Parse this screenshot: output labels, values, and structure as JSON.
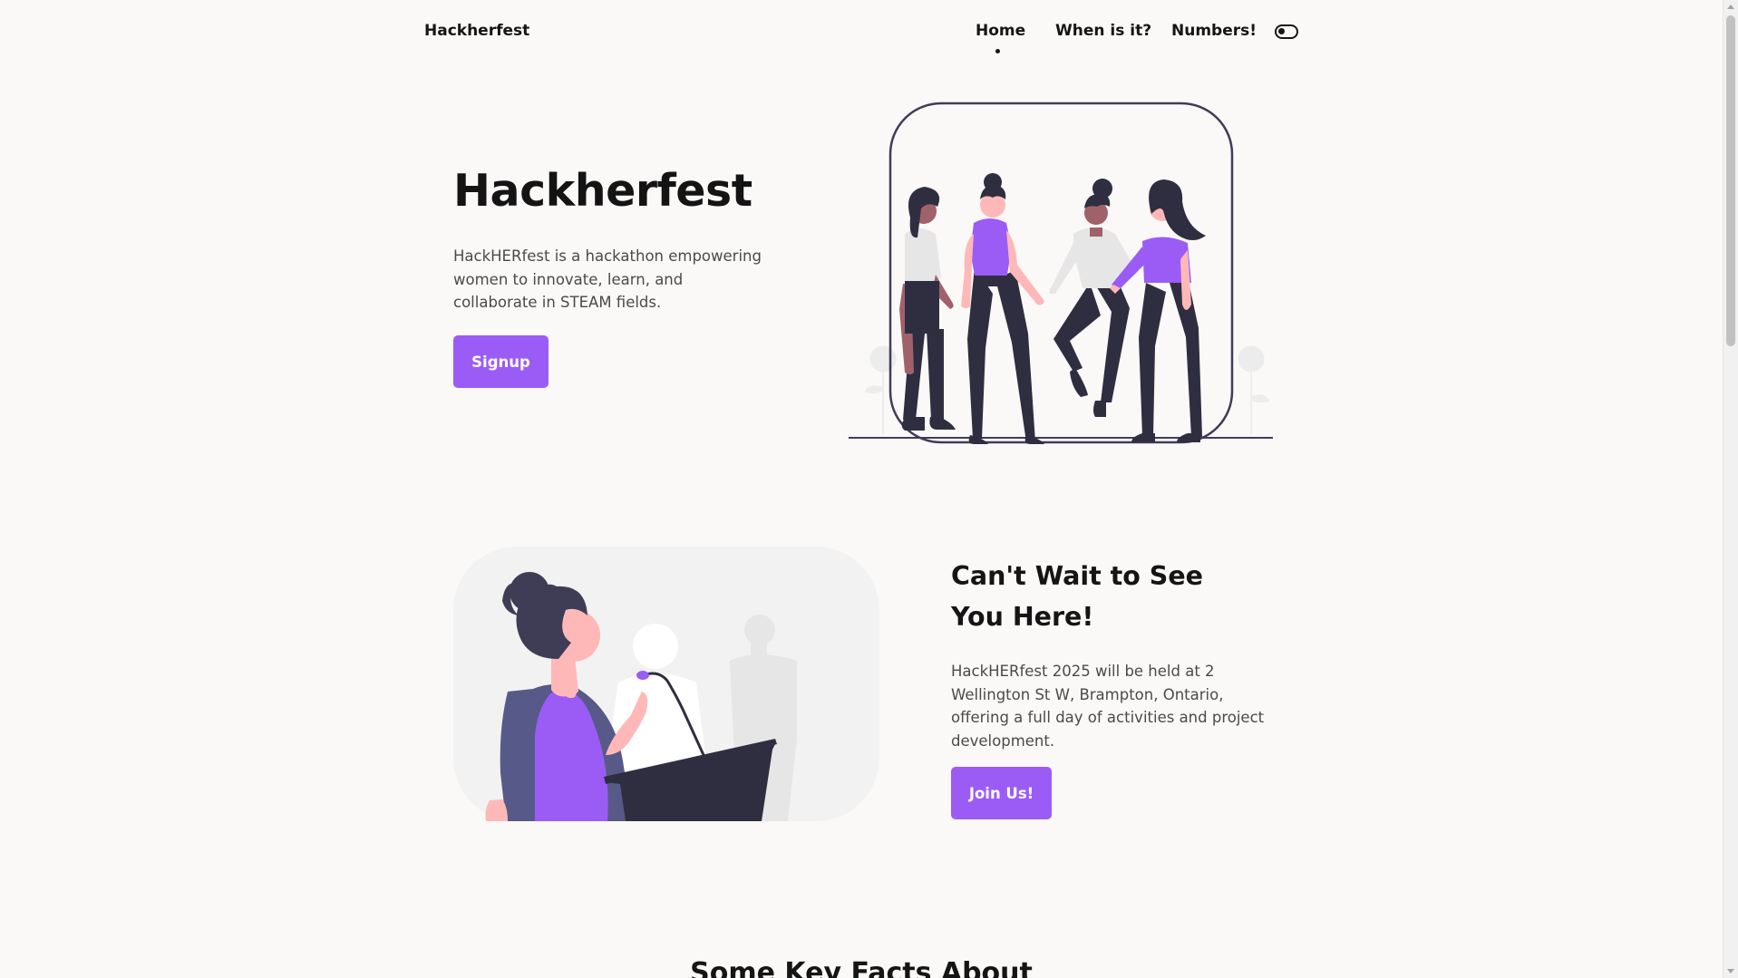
{
  "header": {
    "brand": "Hackherfest",
    "nav": [
      {
        "label": "Home",
        "active": true
      },
      {
        "label": "When is it?"
      },
      {
        "label": "Numbers!"
      }
    ],
    "theme_toggle_icon": "toggle-switch-icon"
  },
  "hero": {
    "title": "Hackherfest",
    "description": "HackHERfest is a hackathon empowering women to innovate, learn, and collaborate in STEAM fields.",
    "button_label": "Signup",
    "illustration": "women-holding-hands-illustration"
  },
  "event": {
    "title": "Can't Wait to See You Here!",
    "description": "HackHERfest 2025 will be held at 2 Wellington St W, Brampton, Ontario, offering a full day of activities and project development.",
    "button_label": "Join Us!",
    "illustration": "speaker-at-podium-illustration"
  },
  "facts": {
    "title": "Some Key Facts About"
  },
  "colors": {
    "accent": "#9b5cf6",
    "background": "#fbf9f8",
    "text": "#151515",
    "muted_text": "#4a4a4a",
    "dark_figure": "#2f2e41",
    "skin_light": "#ffb8b8",
    "skin_dark": "#a0616a"
  }
}
